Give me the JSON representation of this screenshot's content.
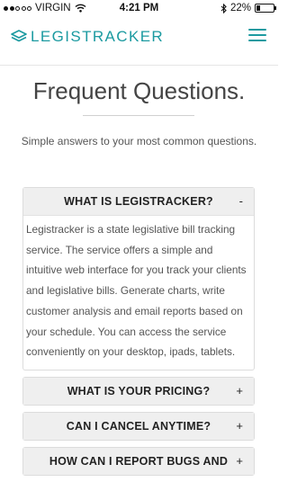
{
  "status_bar": {
    "carrier": "VIRGIN",
    "time": "4:21 PM",
    "battery": "22%",
    "battery_level": 0.22,
    "icons": [
      "signal-icon",
      "wifi-icon",
      "bluetooth-icon",
      "battery-icon"
    ]
  },
  "header": {
    "logo_text": "LEGISTRACKER",
    "brand_color": "#1b9aa0",
    "menu_icon": "hamburger-menu-icon"
  },
  "hero": {
    "title": "Frequent Questions.",
    "subtitle": "Simple answers to your most common questions."
  },
  "faq": [
    {
      "question": "WHAT IS LEGISTRACKER?",
      "toggle": "-",
      "answer": "Legistracker is a state legislative bill tracking service. The service offers a simple and intuitive web interface for you track your clients and legislative bills. Generate charts, write customer analysis and email reports based on your schedule. You can access the service conveniently on your desktop, ipads, tablets."
    },
    {
      "question": "WHAT IS YOUR PRICING?",
      "toggle": "+"
    },
    {
      "question": "CAN I CANCEL ANYTIME?",
      "toggle": "+"
    },
    {
      "question": "HOW CAN I REPORT BUGS AND",
      "toggle": "+"
    }
  ]
}
